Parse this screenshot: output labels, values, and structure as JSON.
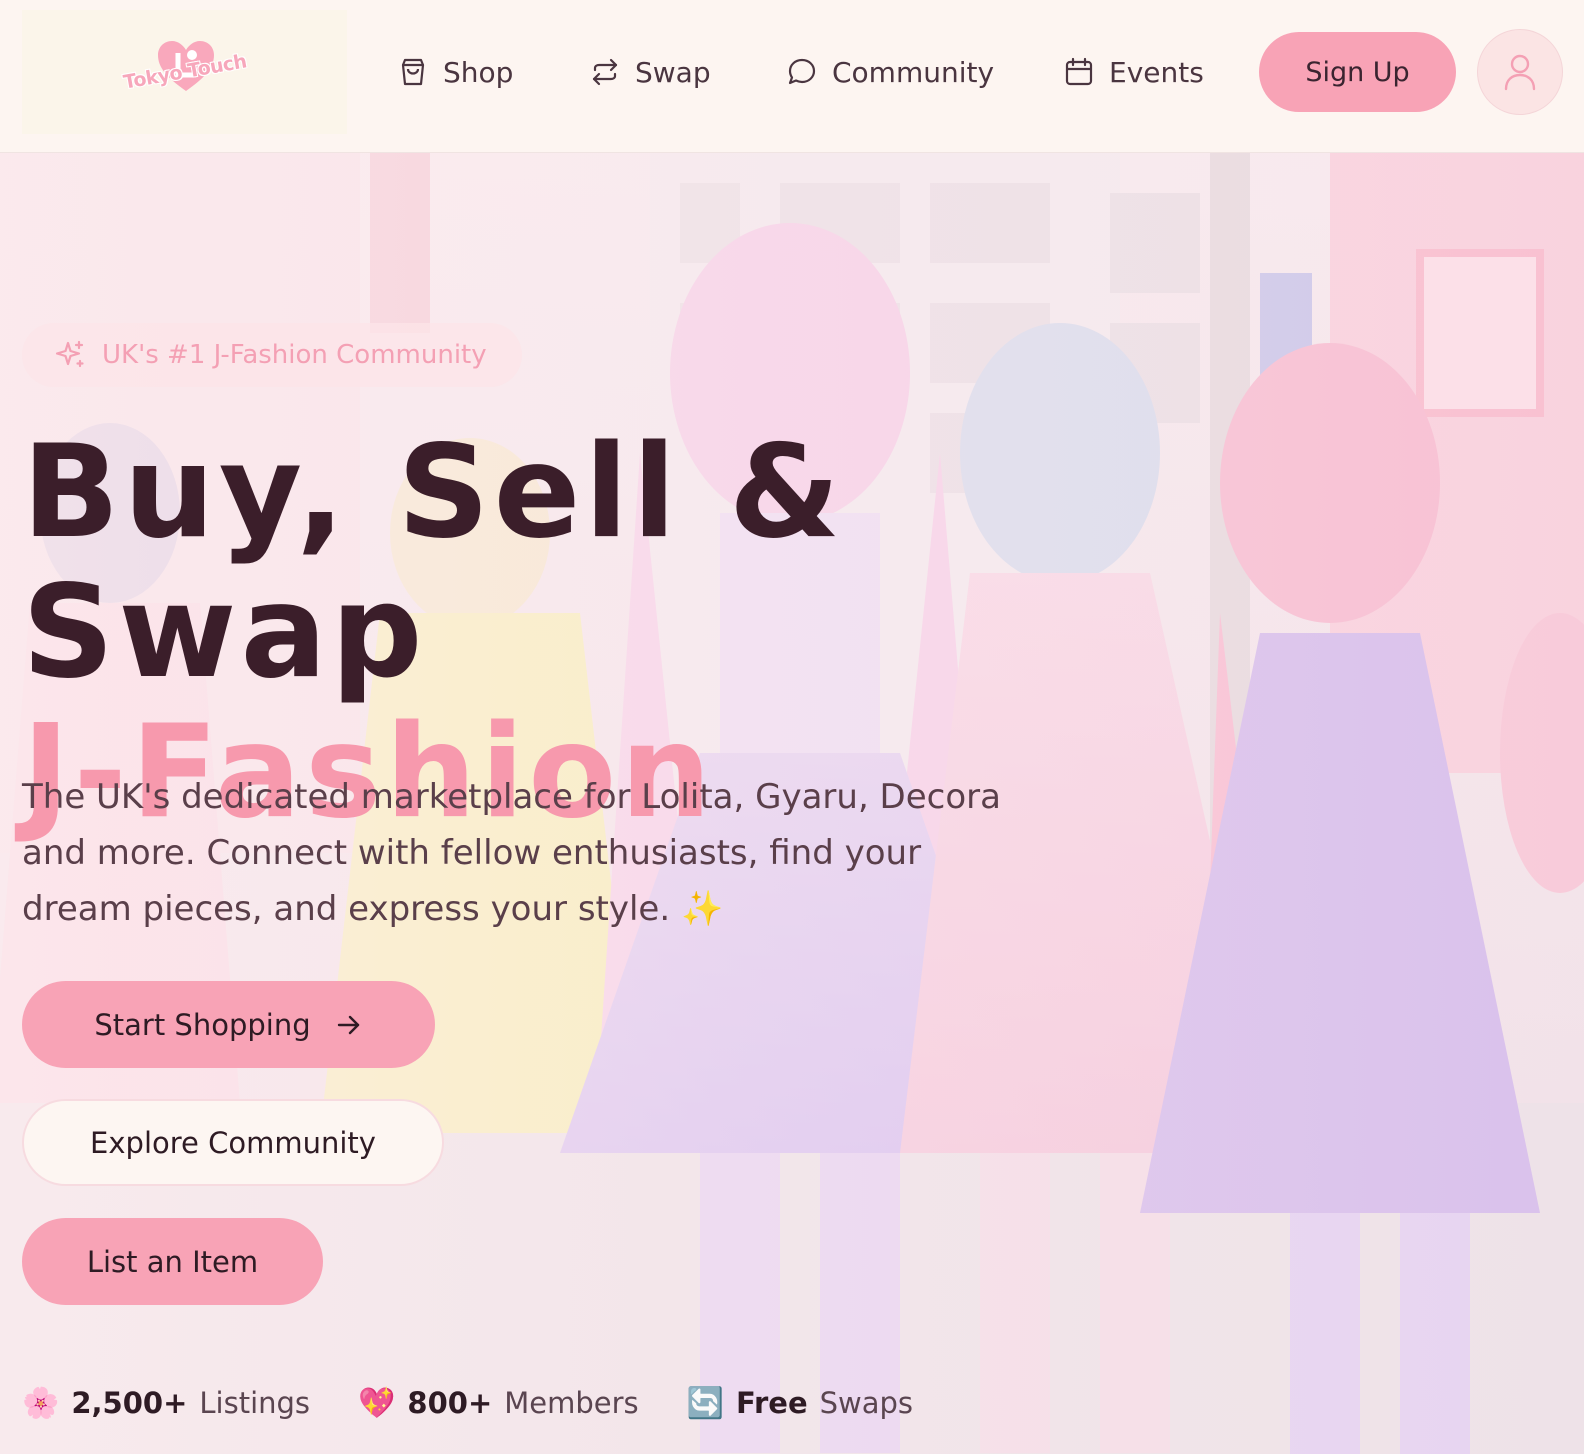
{
  "brand": {
    "name": "Tokyo Touch",
    "accent": "#f8a3b6",
    "text_dark": "#3b1e2a"
  },
  "header": {
    "nav": [
      {
        "label": "Shop",
        "icon": "shopping-bag-icon"
      },
      {
        "label": "Swap",
        "icon": "swap-arrows-icon"
      },
      {
        "label": "Community",
        "icon": "chat-bubble-icon"
      },
      {
        "label": "Events",
        "icon": "calendar-icon"
      }
    ],
    "signup_label": "Sign Up",
    "account_icon": "user-icon"
  },
  "hero": {
    "badge": {
      "icon": "sparkle-icon",
      "text": "UK's #1 J-Fashion Community"
    },
    "headline_line1": "Buy, Sell & Swap",
    "headline_line2": "J-Fashion",
    "lead": "The UK's dedicated marketplace for Lolita, Gyaru, Decora and more. Connect with fellow enthusiasts, find your dream pieces, and express your style. ✨",
    "buttons": {
      "primary": "Start Shopping",
      "secondary": "Explore Community",
      "tertiary": "List an Item"
    },
    "stats": [
      {
        "emoji": "🌸",
        "value": "2,500+",
        "label": "Listings"
      },
      {
        "emoji": "💖",
        "value": "800+",
        "label": "Members"
      },
      {
        "emoji": "🔄",
        "value": "Free",
        "label": "Swaps"
      }
    ]
  }
}
